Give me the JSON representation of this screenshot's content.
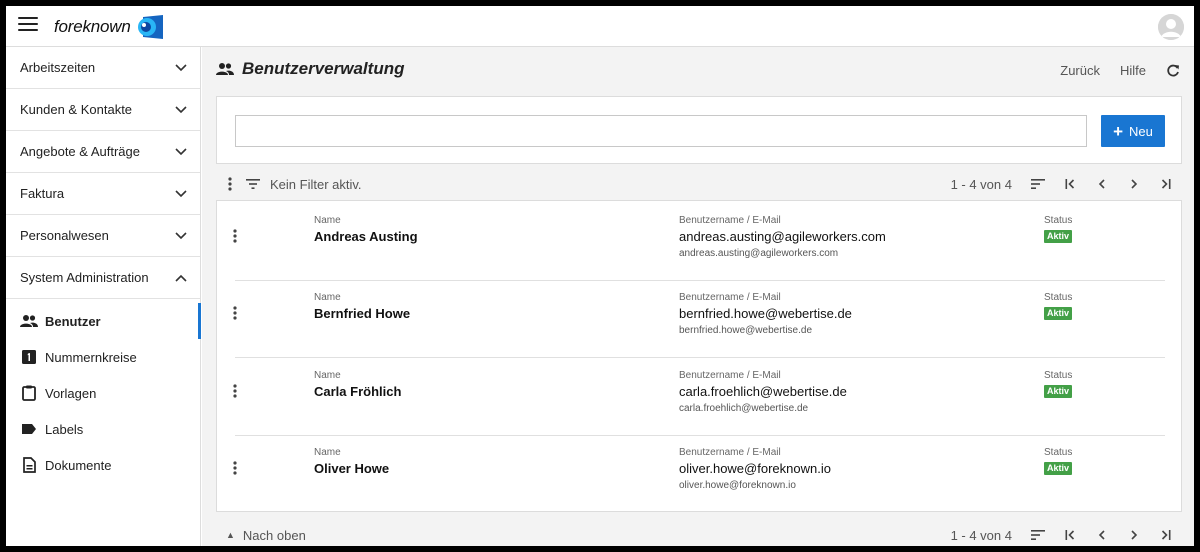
{
  "app": {
    "logo_text": "foreknown",
    "accent": "#1976d2",
    "badge_color": "#43a047"
  },
  "sidebar": {
    "groups": [
      {
        "label": "Arbeitszeiten",
        "expanded": false
      },
      {
        "label": "Kunden & Kontakte",
        "expanded": false
      },
      {
        "label": "Angebote & Aufträge",
        "expanded": false
      },
      {
        "label": "Faktura",
        "expanded": false
      },
      {
        "label": "Personalwesen",
        "expanded": false
      },
      {
        "label": "System Administration",
        "expanded": true
      }
    ],
    "items": [
      {
        "label": "Benutzer",
        "icon": "people-icon",
        "active": true
      },
      {
        "label": "Nummernkreise",
        "icon": "number-one-icon",
        "active": false
      },
      {
        "label": "Vorlagen",
        "icon": "clipboard-icon",
        "active": false
      },
      {
        "label": "Labels",
        "icon": "label-icon",
        "active": false
      },
      {
        "label": "Dokumente",
        "icon": "document-icon",
        "active": false
      }
    ]
  },
  "header": {
    "title": "Benutzerverwaltung",
    "back_label": "Zurück",
    "help_label": "Hilfe"
  },
  "search": {
    "value": "",
    "new_label": "Neu"
  },
  "toolbar": {
    "filter_text": "Kein Filter aktiv.",
    "page_info": "1 - 4 von 4"
  },
  "columns": {
    "name": "Name",
    "username": "Benutzername / E-Mail",
    "status": "Status"
  },
  "users": [
    {
      "name": "Andreas Austing",
      "username": "andreas.austing@agileworkers.com",
      "email": "andreas.austing@agileworkers.com",
      "status": "Aktiv"
    },
    {
      "name": "Bernfried Howe",
      "username": "bernfried.howe@webertise.de",
      "email": "bernfried.howe@webertise.de",
      "status": "Aktiv"
    },
    {
      "name": "Carla Fröhlich",
      "username": "carla.froehlich@webertise.de",
      "email": "carla.froehlich@webertise.de",
      "status": "Aktiv"
    },
    {
      "name": "Oliver Howe",
      "username": "oliver.howe@foreknown.io",
      "email": "oliver.howe@foreknown.io",
      "status": "Aktiv"
    }
  ],
  "bottom": {
    "to_top_label": "Nach oben",
    "page_info": "1 - 4 von 4"
  }
}
